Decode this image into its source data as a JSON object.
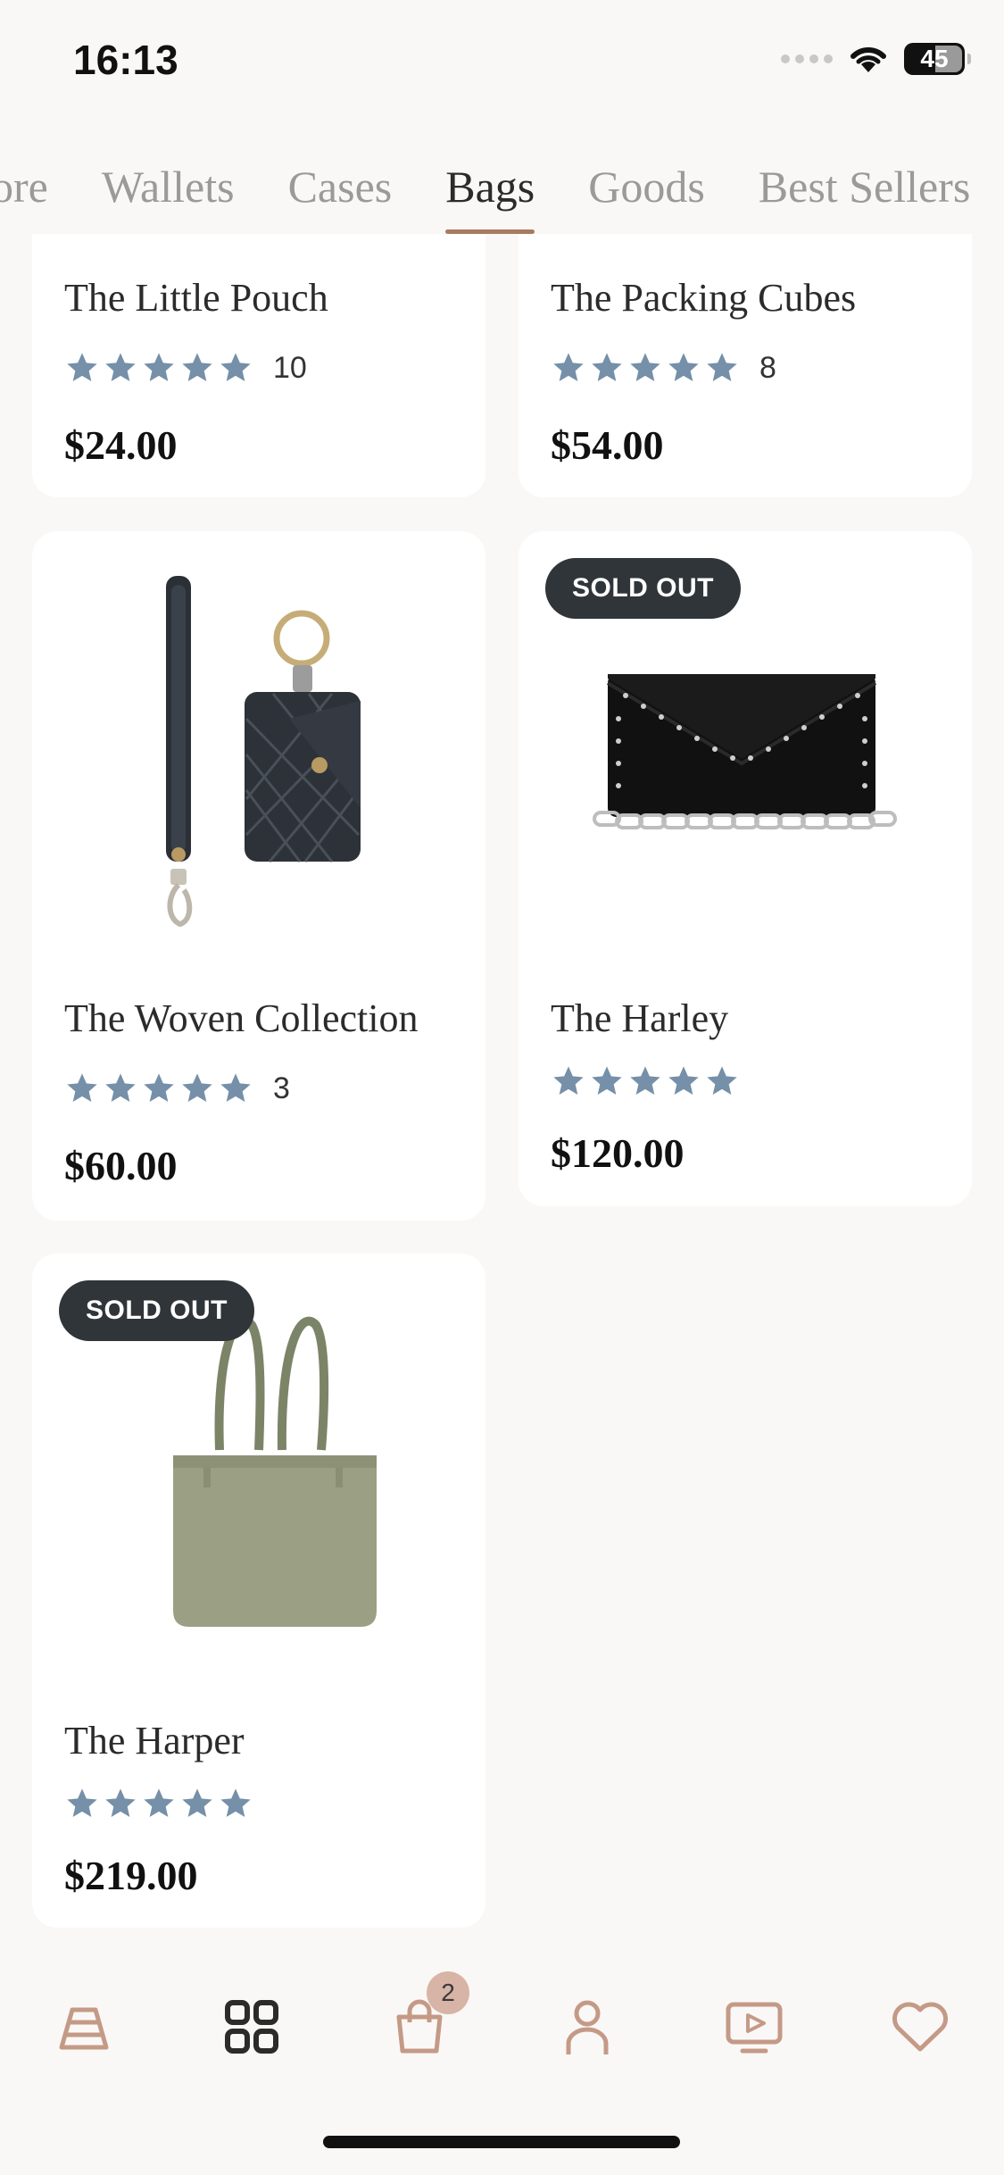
{
  "status_bar": {
    "time": "16:13",
    "battery": "45"
  },
  "tabs": [
    {
      "label": "ore"
    },
    {
      "label": "Wallets"
    },
    {
      "label": "Cases"
    },
    {
      "label": "Bags"
    },
    {
      "label": "Goods"
    },
    {
      "label": "Best Sellers"
    }
  ],
  "active_tab": "Bags",
  "products": [
    {
      "name": "The Little Pouch",
      "rating": 5,
      "reviews": "10",
      "price": "$24.00"
    },
    {
      "name": "The Packing Cubes",
      "rating": 5,
      "reviews": "8",
      "price": "$54.00"
    },
    {
      "name": "The Woven Collection",
      "rating": 5,
      "reviews": "3",
      "price": "$60.00"
    },
    {
      "name": "The Harley",
      "rating": 5,
      "reviews": "",
      "price": "$120.00",
      "badge": "SOLD OUT"
    },
    {
      "name": "The Harper",
      "rating": 5,
      "reviews": "",
      "price": "$219.00",
      "badge": "SOLD OUT"
    }
  ],
  "nav": {
    "items": [
      "home-icon",
      "categories-icon",
      "cart-icon",
      "account-icon",
      "video-icon",
      "wishlist-icon"
    ],
    "cart_count": "2"
  },
  "colors": {
    "accent": "#a87b5f",
    "star": "#7590a8",
    "badge_bg": "#2f3538",
    "nav_icon": "#c49a87"
  }
}
